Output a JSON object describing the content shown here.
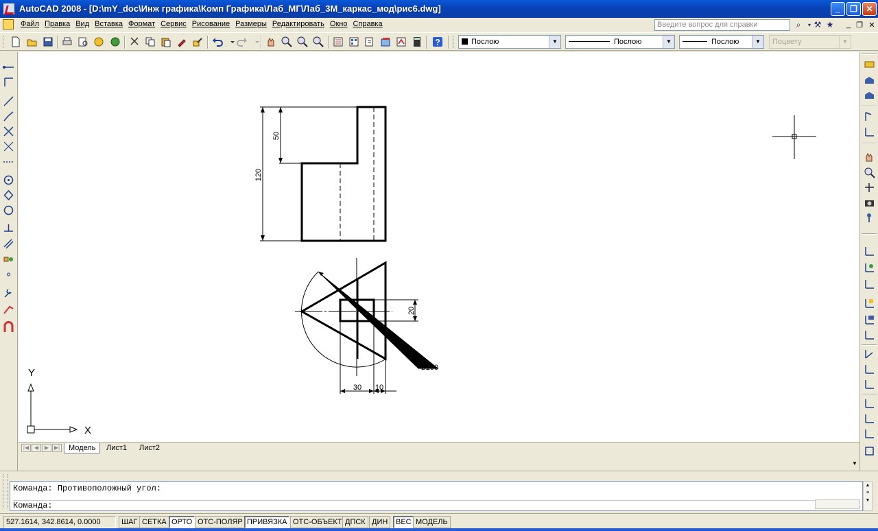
{
  "window": {
    "title": "AutoCAD 2008 - [D:\\mY_doc\\Инж графика\\Комп Графика\\Лаб_МГ\\Лаб_3М_каркас_мод\\рис6.dwg]",
    "minimize_symbol": "_",
    "maximize_symbol": "❐",
    "close_symbol": "✕"
  },
  "menu": {
    "items": [
      {
        "label": "Файл"
      },
      {
        "label": "Правка"
      },
      {
        "label": "Вид"
      },
      {
        "label": "Вставка"
      },
      {
        "label": "Формат"
      },
      {
        "label": "Сервис"
      },
      {
        "label": "Рисование"
      },
      {
        "label": "Размеры"
      },
      {
        "label": "Редактировать"
      },
      {
        "label": "Окно"
      },
      {
        "label": "Справка"
      }
    ],
    "help_placeholder": "Введите вопрос для справки"
  },
  "properties": {
    "color": "Послою",
    "linetype": "Послою",
    "lineweight": "Послою",
    "plotstyle": "Поцвету"
  },
  "drawing": {
    "dim_50": "50",
    "dim_120": "120",
    "dim_20": "20",
    "dim_30": "30",
    "dim_10": "10",
    "dim_diameter": "⌀100",
    "ucs_x": "X",
    "ucs_y": "Y"
  },
  "layout_tabs": {
    "tabs": [
      {
        "label": "Модель",
        "active": true
      },
      {
        "label": "Лист1",
        "active": false
      },
      {
        "label": "Лист2",
        "active": false
      }
    ]
  },
  "command": {
    "history_line": "Команда: Противоположный угол:",
    "prompt": "Команда:"
  },
  "status": {
    "coordinates": "527.1614, 342.8614, 0.0000",
    "toggles": [
      {
        "label": "ШАГ",
        "on": false
      },
      {
        "label": "СЕТКА",
        "on": false
      },
      {
        "label": "ОРТО",
        "on": true
      },
      {
        "label": "ОТС-ПОЛЯР",
        "on": false
      },
      {
        "label": "ПРИВЯЗКА",
        "on": true
      },
      {
        "label": "ОТС-ОБЪЕКТ",
        "on": false
      },
      {
        "label": "ДПСК",
        "on": false
      },
      {
        "label": "ДИН",
        "on": false
      },
      {
        "label": "ВЕС",
        "on": true
      },
      {
        "label": "МОДЕЛЬ",
        "on": false
      }
    ]
  },
  "colors": {
    "titlebar": "#0a58d8",
    "chrome": "#ece9d8",
    "canvas": "#ffffff"
  }
}
